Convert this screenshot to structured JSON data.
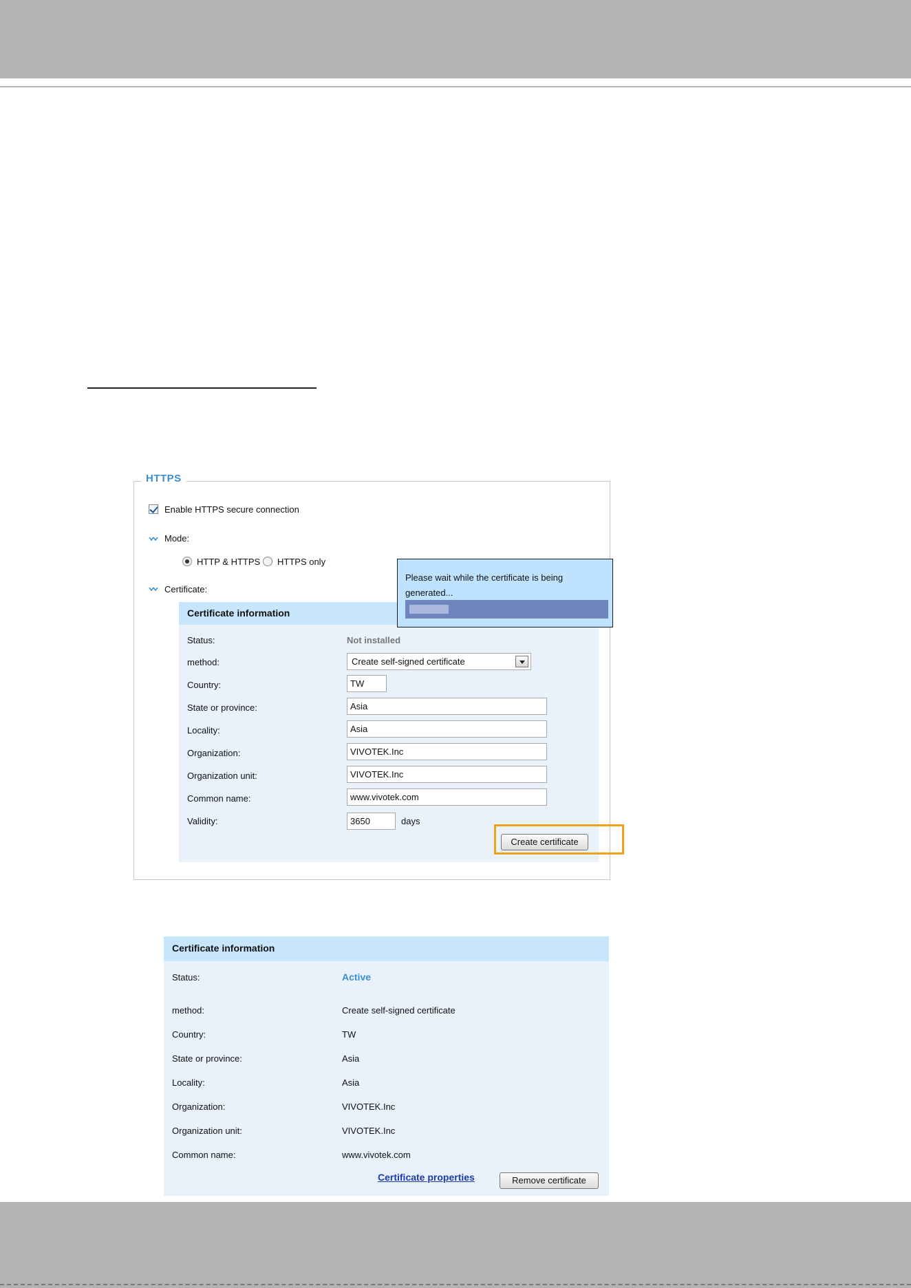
{
  "https": {
    "legend": "HTTPS",
    "enable_label": "Enable HTTPS secure connection",
    "enable_checked": true,
    "mode_label": "Mode:",
    "mode_options": [
      "HTTP & HTTPS",
      "HTTPS only"
    ],
    "mode_selected": "HTTP & HTTPS",
    "certificate_label": "Certificate:",
    "cert_info": {
      "title": "Certificate information",
      "status_label": "Status:",
      "status_value": "Not installed",
      "method_label": "method:",
      "method_value": "Create self-signed certificate",
      "country_label": "Country:",
      "country_value": "TW",
      "state_label": "State or province:",
      "state_value": "Asia",
      "locality_label": "Locality:",
      "locality_value": "Asia",
      "org_label": "Organization:",
      "org_value": "VIVOTEK.Inc",
      "org_unit_label": "Organization unit:",
      "org_unit_value": "VIVOTEK.Inc",
      "common_name_label": "Common name:",
      "common_name_value": "www.vivotek.com",
      "validity_label": "Validity:",
      "validity_value": "3650",
      "validity_unit": "days",
      "create_button": "Create certificate"
    },
    "popup": {
      "message": "Please wait while the certificate is being generated...",
      "progress": 0.2
    }
  },
  "result": {
    "title": "Certificate information",
    "rows": [
      {
        "label": "Status:",
        "value": "Active"
      },
      {
        "label": "method:",
        "value": "Create self-signed certificate"
      },
      {
        "label": "Country:",
        "value": "TW"
      },
      {
        "label": "State or province:",
        "value": "Asia"
      },
      {
        "label": "Locality:",
        "value": "Asia"
      },
      {
        "label": "Organization:",
        "value": "VIVOTEK.Inc"
      },
      {
        "label": "Organization unit:",
        "value": "VIVOTEK.Inc"
      },
      {
        "label": "Common name:",
        "value": "www.vivotek.com"
      }
    ],
    "properties_link": "Certificate properties",
    "remove_button": "Remove certificate"
  },
  "colors": {
    "accent": "#3a8fd0",
    "panel_bg": "#e9f2fa",
    "header_bg": "#c8e6fb",
    "highlight": "#f0a21c",
    "link": "#1a3aa8"
  }
}
